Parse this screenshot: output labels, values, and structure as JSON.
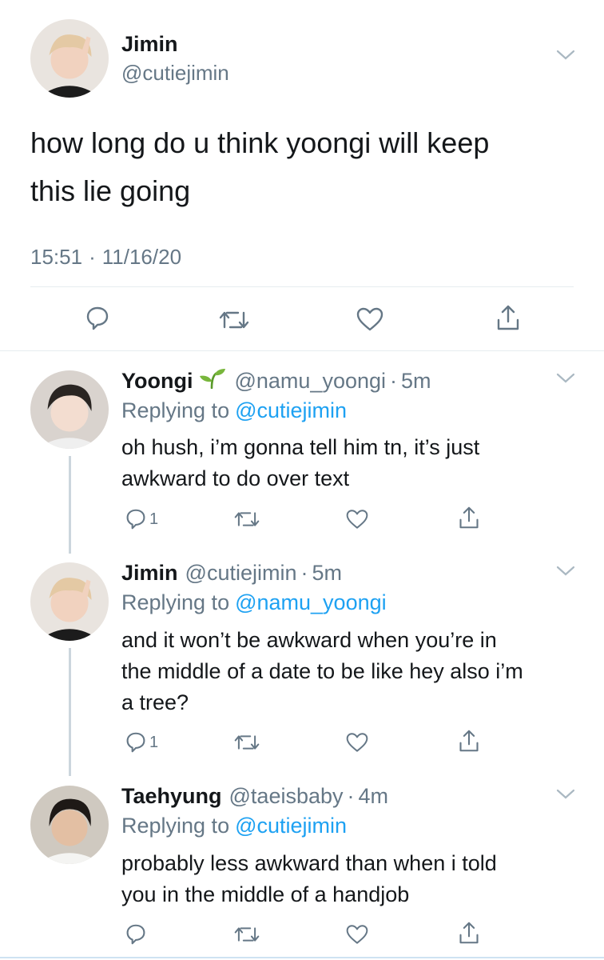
{
  "colors": {
    "accent": "#1da1f2",
    "text": "#14171a",
    "muted": "#657786",
    "divider": "#e6ecf0"
  },
  "main_tweet": {
    "name": "Jimin",
    "handle": "@cutiejimin",
    "text_line1": "how long do u think yoongi will keep",
    "text_line2": "this lie going",
    "time": "15:51",
    "date": "11/16/20",
    "sep": "·"
  },
  "replies": [
    {
      "name": "Yoongi",
      "emoji": "🌱",
      "handle": "@namu_yoongi",
      "time": "5m",
      "replying_prefix": "Replying to",
      "replying_to": "@cutiejimin",
      "lines": [
        "oh hush, i’m gonna tell him tn, it’s just",
        "awkward to do over text"
      ],
      "reply_count": "1"
    },
    {
      "name": "Jimin",
      "handle": "@cutiejimin",
      "time": "5m",
      "replying_prefix": "Replying to",
      "replying_to": "@namu_yoongi",
      "lines": [
        "and it won’t be awkward when you’re in",
        "the middle of a date to be like hey also i’m",
        "a tree?"
      ],
      "reply_count": "1"
    },
    {
      "name": "Taehyung",
      "handle": "@taeisbaby",
      "time": "4m",
      "replying_prefix": "Replying to",
      "replying_to": "@cutiejimin",
      "lines": [
        "probably less awkward than when i told",
        "you in the middle of a handjob"
      ],
      "reply_count": ""
    }
  ],
  "icons": [
    "chevron-down-icon",
    "reply-icon",
    "retweet-icon",
    "like-icon",
    "share-icon",
    "sprout-emoji"
  ]
}
